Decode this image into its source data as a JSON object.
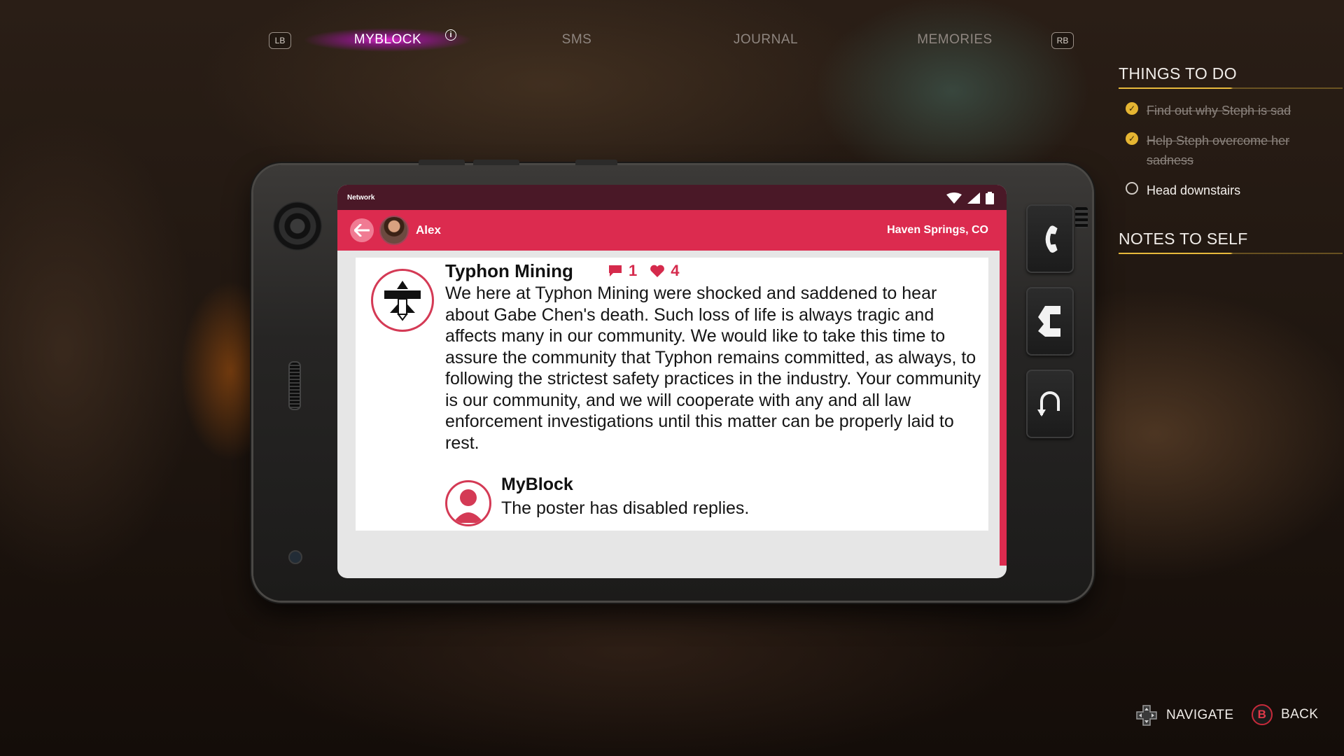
{
  "nav": {
    "left_bumper": "LB",
    "right_bumper": "RB",
    "tabs": [
      {
        "label": "MYBLOCK",
        "active": true,
        "alert_icon": "info-circle-icon"
      },
      {
        "label": "SMS",
        "active": false
      },
      {
        "label": "JOURNAL",
        "active": false
      },
      {
        "label": "MEMORIES",
        "active": false
      }
    ],
    "active_glow_color": "#e02ad2"
  },
  "things_to_do": {
    "heading": "THINGS TO DO",
    "items": [
      {
        "text": "Find out why Steph is sad",
        "done": true
      },
      {
        "text": "Help Steph overcome her sadness",
        "done": true
      },
      {
        "text": "Head downstairs",
        "done": false
      }
    ]
  },
  "notes_to_self": {
    "heading": "NOTES TO SELF"
  },
  "phone": {
    "status_bar": {
      "carrier": "Network",
      "icons": [
        "wifi-icon",
        "signal-icon",
        "battery-icon"
      ]
    },
    "app_bar": {
      "user_name": "Alex",
      "location": "Haven Springs, CO",
      "accent_color": "#dc2b4f"
    },
    "post": {
      "author": "Typhon Mining",
      "comment_count": "1",
      "like_count": "4",
      "body": "We here at Typhon Mining were shocked and saddened to hear about Gabe Chen's death. Such loss of life is always tragic and affects many in our community. We would like to take this time to assure the community that Typhon remains committed, as always, to following the strictest safety practices in the industry. Your community is our community, and we will cooperate with any and all law enforcement investigations until this matter can be properly laid to rest.",
      "reply": {
        "author": "MyBlock",
        "text": "The poster has disabled replies."
      }
    },
    "side_keys": [
      "phone-call-icon",
      "app-switch-icon",
      "home-return-icon"
    ]
  },
  "hints": {
    "navigate": "NAVIGATE",
    "back_button": "B",
    "back": "BACK"
  }
}
